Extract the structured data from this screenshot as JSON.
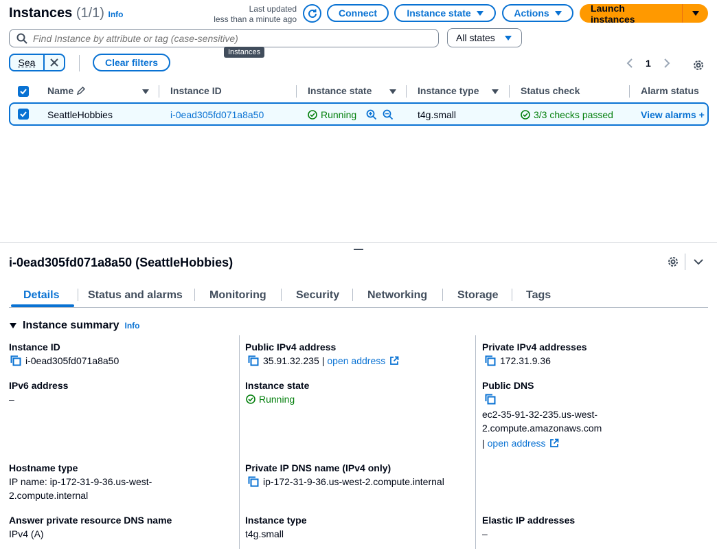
{
  "header": {
    "title": "Instances",
    "count": "(1/1)",
    "info": "Info",
    "last_updated_line1": "Last updated",
    "last_updated_line2": "less than a minute ago",
    "connect": "Connect",
    "instance_state": "Instance state",
    "actions": "Actions",
    "launch": "Launch instances"
  },
  "search": {
    "placeholder": "Find Instance by attribute or tag (case-sensitive)",
    "state_filter": "All states",
    "tooltip": "Instances"
  },
  "filters": {
    "token": "Sea",
    "clear": "Clear filters",
    "page": "1"
  },
  "table": {
    "columns": [
      "Name",
      "Instance ID",
      "Instance state",
      "Instance type",
      "Status check",
      "Alarm status"
    ],
    "row": {
      "name": "SeattleHobbies",
      "instance_id": "i-0ead305fd071a8a50",
      "state": "Running",
      "type": "t4g.small",
      "status_check": "3/3 checks passed",
      "alarm": "View alarms"
    }
  },
  "details": {
    "title": "i-0ead305fd071a8a50 (SeattleHobbies)",
    "tabs": [
      "Details",
      "Status and alarms",
      "Monitoring",
      "Security",
      "Networking",
      "Storage",
      "Tags"
    ],
    "summary": "Instance summary",
    "info": "Info",
    "fields": {
      "instance_id_label": "Instance ID",
      "instance_id": "i-0ead305fd071a8a50",
      "public_ipv4_label": "Public IPv4 address",
      "public_ipv4": "35.91.32.235",
      "open_address": "open address",
      "private_ipv4_label": "Private IPv4 addresses",
      "private_ipv4": "172.31.9.36",
      "ipv6_label": "IPv6 address",
      "ipv6": "–",
      "instance_state_label": "Instance state",
      "instance_state": "Running",
      "public_dns_label": "Public DNS",
      "public_dns_1": "ec2-35-91-32-235.us-west-",
      "public_dns_2": "2.compute.amazonaws.com",
      "hostname_type_label": "Hostname type",
      "hostname_1": "IP name: ip-172-31-9-36.us-west-",
      "hostname_2": "2.compute.internal",
      "private_dns_label": "Private IP DNS name (IPv4 only)",
      "private_dns": "ip-172-31-9-36.us-west-2.compute.internal",
      "answer_dns_label": "Answer private resource DNS name",
      "answer_dns": "IPv4 (A)",
      "instance_type_label": "Instance type",
      "instance_type": "t4g.small",
      "elastic_ip_label": "Elastic IP addresses",
      "elastic_ip": "–"
    }
  }
}
